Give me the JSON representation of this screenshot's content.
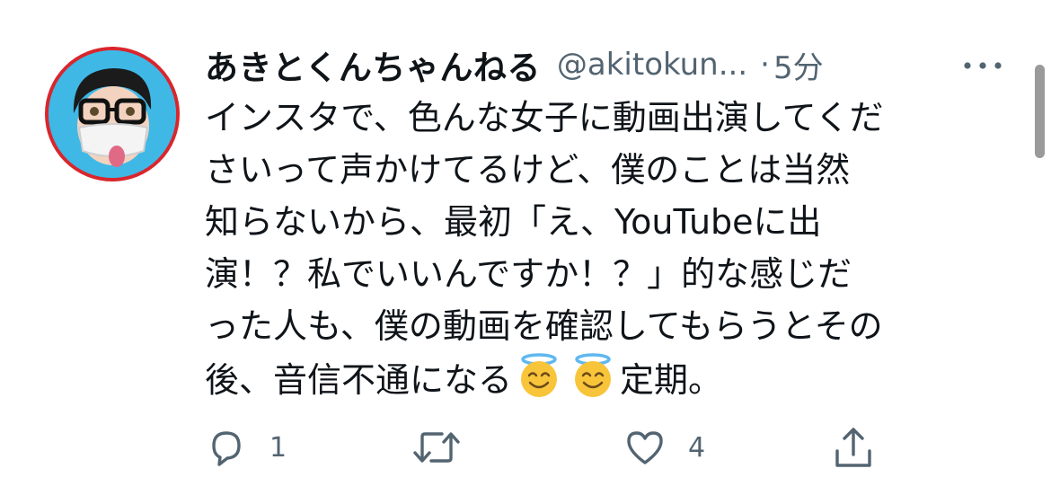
{
  "author": {
    "display_name": "あきとくんちゃんねる",
    "handle": "@akitokun...",
    "separator": "·",
    "time_ago": "5分"
  },
  "tweet": {
    "lines": [
      "インスタで、色んな女子に動画出演してくだ",
      "さいって声かけてるけど、僕のことは当然",
      "知らないから、最初「え、YouTubeに出",
      "演！？私でいいんですか！？」的な感じだ",
      "った人も、僕の動画を確認してもらうとその",
      "後、音信不通になる",
      "定期。"
    ],
    "emojis": [
      "smiling-face-with-halo",
      "smiling-face-with-halo"
    ]
  },
  "actions": {
    "reply_count": "1",
    "retweet_count": "",
    "like_count": "4"
  },
  "icons": {
    "more": "more-dots-icon",
    "reply": "reply-icon",
    "retweet": "retweet-icon",
    "like": "heart-icon",
    "share": "share-icon"
  },
  "colors": {
    "text": "#0f1419",
    "secondary": "#536471",
    "avatar_ring": "#d9262c",
    "avatar_bg": "#3fb8e6"
  }
}
